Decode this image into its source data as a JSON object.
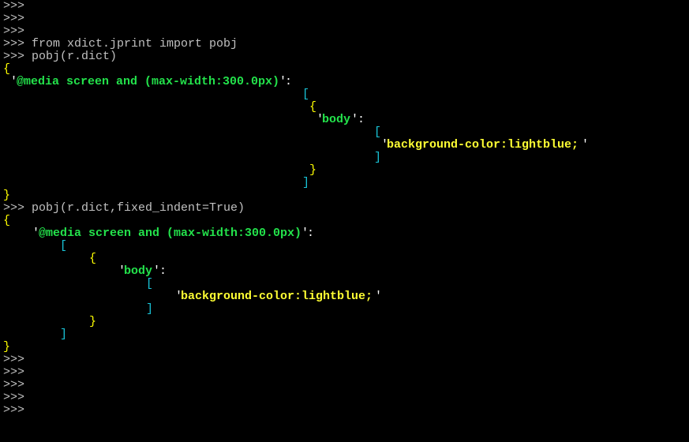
{
  "terminal": {
    "prompt": ">>>",
    "line_from": "from xdict.jprint import pobj",
    "line_call1": "pobj(r.dict)",
    "line_call2": "pobj(r.dict,fixed_indent=True)",
    "open_brace": "{",
    "close_brace": "}",
    "open_bracket": "[",
    "close_bracket": "]",
    "quote": "'",
    "colon": ":",
    "key_media": "@media screen and (max-width:300.0px)",
    "key_body": "body",
    "value_style": "background-color:lightblue;"
  },
  "colors": {
    "background": "#000000",
    "prompt_text": "#c0c0c0",
    "brace": "#ffff00",
    "bracket": "#19c3d6",
    "key_green": "#23e24b",
    "value_yellow": "#ffff33"
  }
}
